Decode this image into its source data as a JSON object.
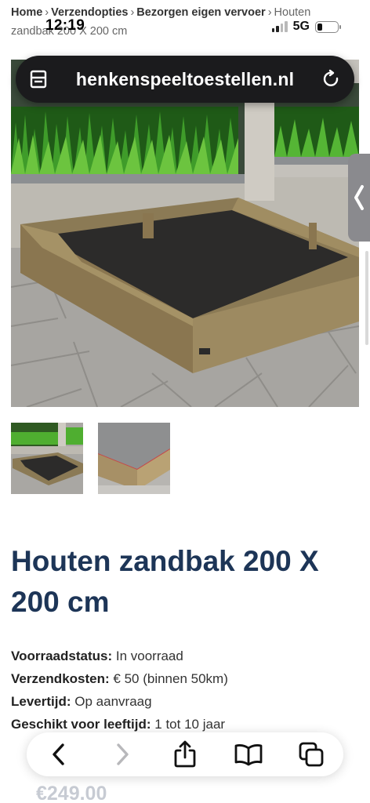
{
  "breadcrumb": {
    "items": [
      "Home",
      "Verzendopties",
      "Bezorgen eigen vervoer"
    ],
    "current": "Houten zandbak 200 X 200 cm"
  },
  "status_bar": {
    "time": "12:19",
    "network": "5G"
  },
  "url_bar": {
    "domain": "henkenspeeltoestellen.nl"
  },
  "product": {
    "title": "Houten zandbak 200 X 200 cm",
    "details": [
      {
        "label": "Voorraadstatus:",
        "value": "In voorraad"
      },
      {
        "label": "Verzendkosten:",
        "value": "€ 50 (binnen 50km)"
      },
      {
        "label": "Levertijd:",
        "value": "Op aanvraag"
      },
      {
        "label": "Geschikt voor leeftijd:",
        "value": "1 tot 10 jaar"
      }
    ],
    "price": "€249.00"
  },
  "icons": {
    "tabs": "tabs-icon",
    "reload": "reload-icon",
    "back": "chevron-left-icon",
    "forward": "chevron-right-icon",
    "share": "share-icon",
    "bookmarks": "book-icon",
    "tab_overview": "tabs-overview-icon",
    "side_handle": "chevron-left-icon"
  },
  "colors": {
    "title": "#1d3557",
    "url_bar_bg": "#1b1b1d"
  }
}
